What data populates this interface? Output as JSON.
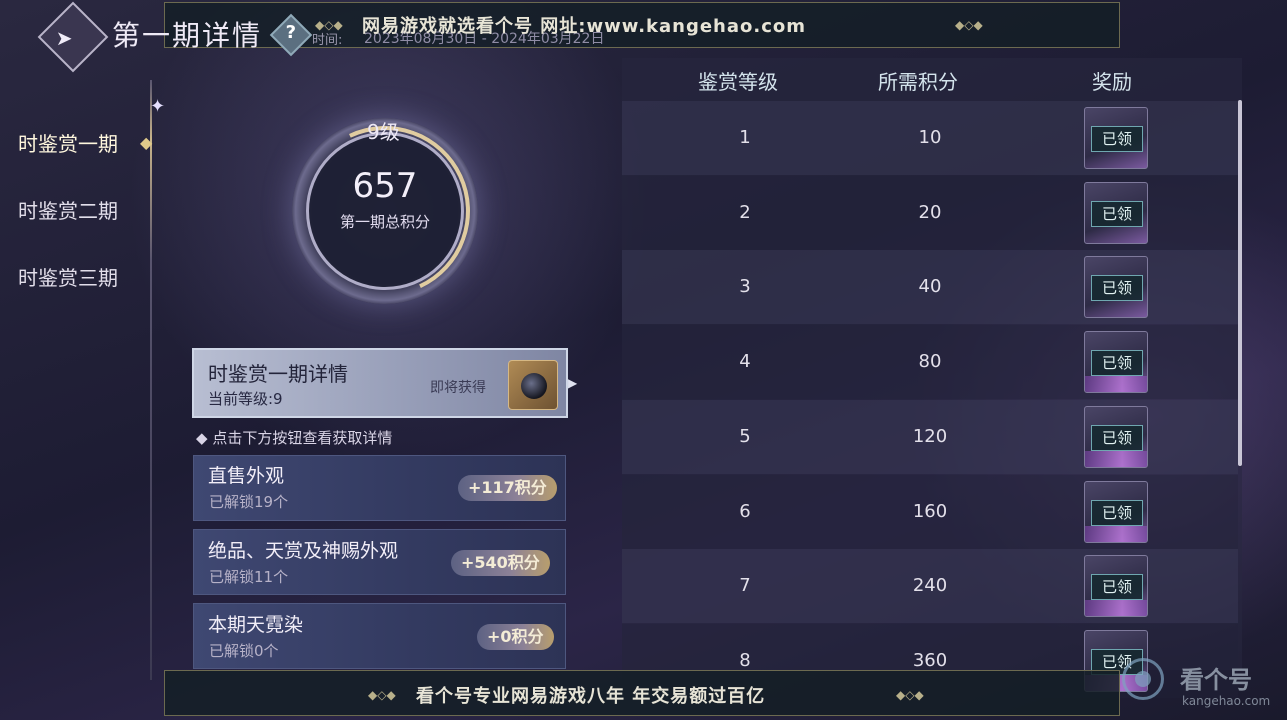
{
  "header": {
    "title": "第一期详情",
    "help_icon": "?",
    "time_label": "时间:",
    "time_value": "2023年08月30日 - 2024年03月22日",
    "back_icon": "back-arrow-icon"
  },
  "banner_top": {
    "text": "网易游戏就选看个号  网址:www.kangehao.com"
  },
  "banner_bottom": {
    "text": "看个号专业网易游戏八年  年交易额过百亿"
  },
  "sidebar": {
    "items": [
      {
        "label": "时鉴赏一期",
        "active": true
      },
      {
        "label": "时鉴赏二期",
        "active": false
      },
      {
        "label": "时鉴赏三期",
        "active": false
      }
    ]
  },
  "score": {
    "level": "9级",
    "total": "657",
    "label": "第一期总积分"
  },
  "period_card": {
    "title": "时鉴赏一期详情",
    "current_level": "当前等级:9",
    "coming_soon": "即将获得"
  },
  "hint": "点击下方按钮查看获取详情",
  "sources": [
    {
      "title": "直售外观",
      "unlocked": "已解锁19个",
      "points": "+117积分"
    },
    {
      "title": "绝品、天赏及神赐外观",
      "unlocked": "已解锁11个",
      "points": "+540积分"
    },
    {
      "title": "本期天霓染",
      "unlocked": "已解锁0个",
      "points": "+0积分"
    }
  ],
  "table": {
    "headers": [
      "鉴赏等级",
      "所需积分",
      "奖励"
    ],
    "rows": [
      {
        "level": "1",
        "points": "10",
        "status": "已领"
      },
      {
        "level": "2",
        "points": "20",
        "status": "已领"
      },
      {
        "level": "3",
        "points": "40",
        "status": "已领"
      },
      {
        "level": "4",
        "points": "80",
        "status": "已领"
      },
      {
        "level": "5",
        "points": "120",
        "status": "已领"
      },
      {
        "level": "6",
        "points": "160",
        "status": "已领"
      },
      {
        "level": "7",
        "points": "240",
        "status": "已领"
      },
      {
        "level": "8",
        "points": "360",
        "status": "已领"
      }
    ]
  },
  "watermark": {
    "brand": "看个号",
    "url": "kangehao.com"
  }
}
